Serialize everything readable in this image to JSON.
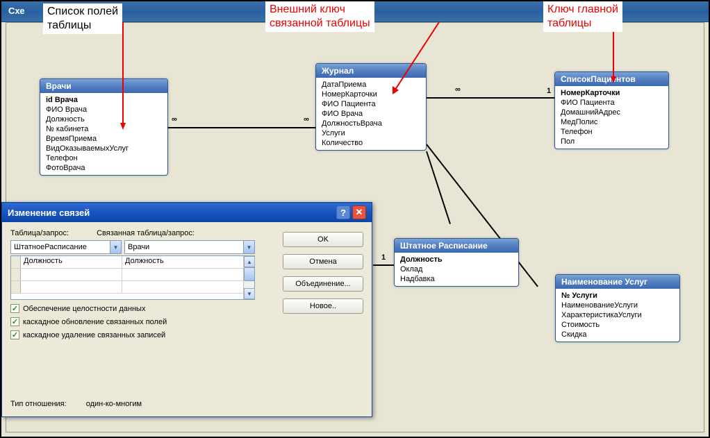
{
  "app_title": "Схе",
  "annotations": {
    "a1": "Список полей\nтаблицы",
    "a2": "Внешний ключ\nсвязанной таблицы",
    "a3": "Ключ главной\nтаблицы"
  },
  "tables": {
    "vrachi": {
      "title": "Врачи",
      "fields": [
        "id Врача",
        "ФИО Врача",
        "Должность",
        "№ кабинета",
        "ВремяПриема",
        "ВидОказываемыхУслуг",
        "Телефон",
        "ФотоВрача"
      ],
      "key_index": 0
    },
    "zhurnal": {
      "title": "Журнал",
      "fields": [
        "ДатаПриема",
        "НомерКарточки",
        "ФИО Пациента",
        "ФИО Врача",
        "ДолжностьВрача",
        "Услуги",
        "Количество"
      ],
      "key_index": -1
    },
    "spisok": {
      "title": "СписокПациентов",
      "fields": [
        "НомерКарточки",
        "ФИО Пациента",
        "ДомашнийАдрес",
        "МедПолис",
        "Телефон",
        "Пол"
      ],
      "key_index": 0
    },
    "shtat": {
      "title": "Штатное Расписание",
      "fields": [
        "Должность",
        "Оклад",
        "Надбавка"
      ],
      "key_index": 0
    },
    "uslugi": {
      "title": "Наименование Услуг",
      "fields": [
        "№ Услуги",
        "НаименованиеУслуги",
        "ХарактеристикаУслуги",
        "Стоимость",
        "Скидка"
      ],
      "key_index": 0
    }
  },
  "relations": {
    "many_symbol": "∞",
    "one_symbol": "1"
  },
  "dialog": {
    "title": "Изменение связей",
    "label_table": "Таблица/запрос:",
    "label_related": "Связанная таблица/запрос:",
    "combo_left": "ШтатноеРасписание",
    "combo_right": "Врачи",
    "grid_left": "Должность",
    "grid_right": "Должность",
    "chk1": "Обеспечение целостности данных",
    "chk2": "каскадное обновление связанных полей",
    "chk3": "каскадное удаление связанных записей",
    "reltype_label": "Тип отношения:",
    "reltype_value": "один-ко-многим",
    "btn_ok": "OK",
    "btn_cancel": "Отмена",
    "btn_join": "Объединение...",
    "btn_new": "Новое.."
  }
}
